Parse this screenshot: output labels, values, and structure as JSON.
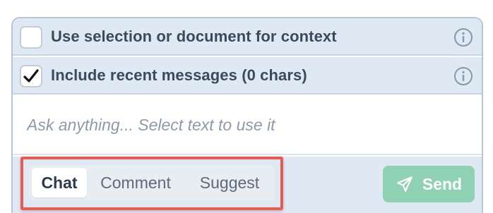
{
  "options": [
    {
      "label": "Use selection or document for context",
      "checked": false,
      "icon": "info-icon"
    },
    {
      "label": "Include recent messages (0 chars)",
      "checked": true,
      "icon": "info-icon"
    }
  ],
  "input": {
    "placeholder": "Ask anything... Select text to use it",
    "value": ""
  },
  "modes": {
    "items": [
      "Chat",
      "Comment",
      "Suggest"
    ],
    "selected": "Chat"
  },
  "send": {
    "label": "Send",
    "icon": "paper-plane-icon",
    "color": "#8fd1b3"
  },
  "colors": {
    "panel_bg": "#dfe9f4",
    "border": "#b7c6d6",
    "highlight": "#ea5a52",
    "text": "#3d4a5c"
  }
}
